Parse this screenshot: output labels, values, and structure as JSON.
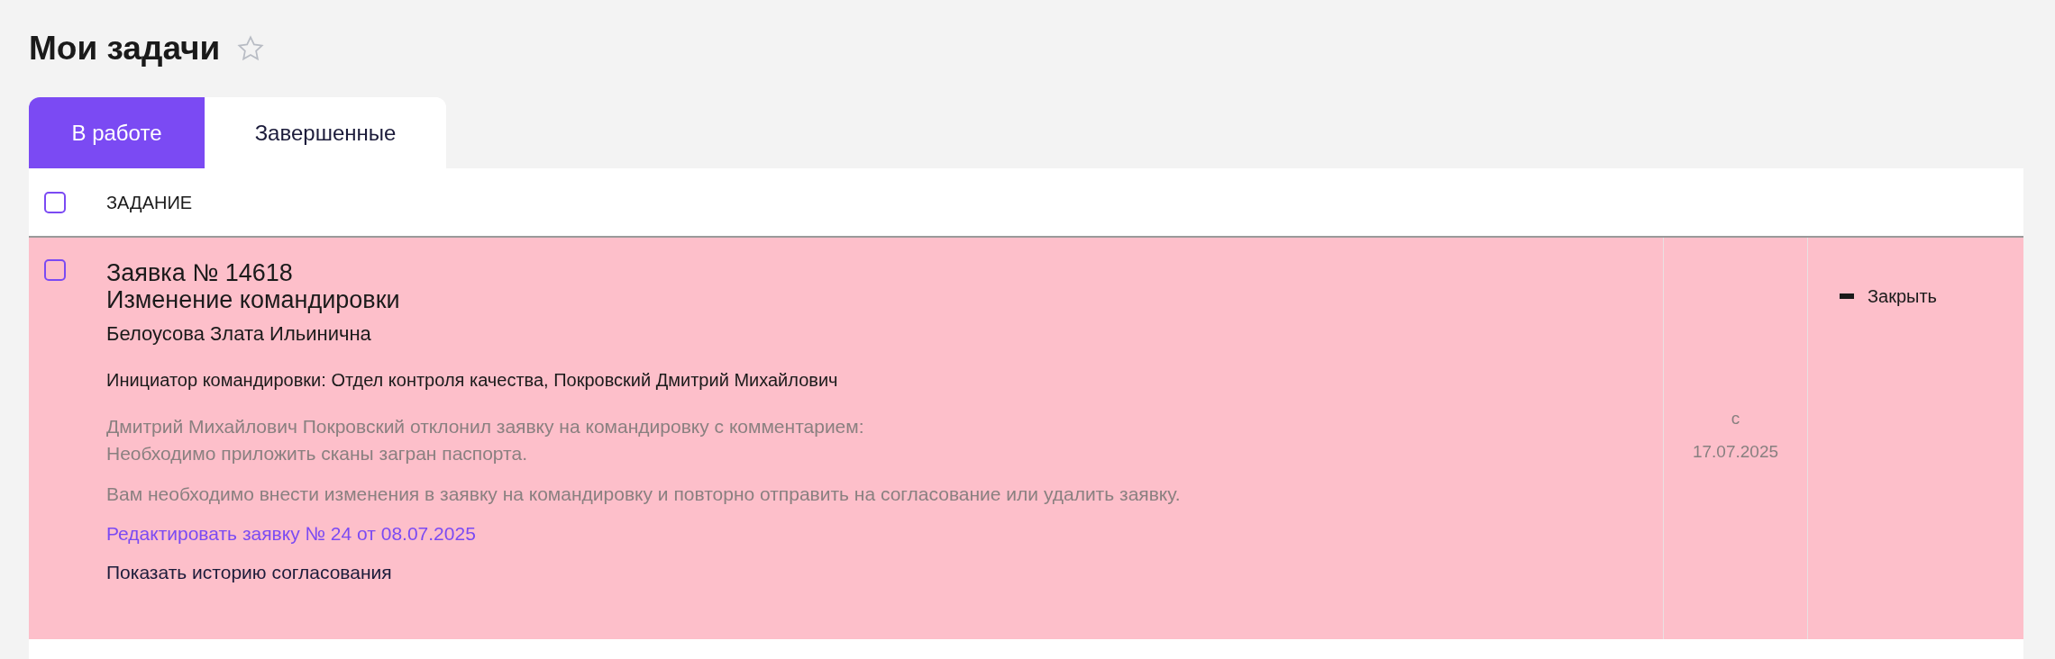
{
  "page_title": "Мои задачи",
  "favorite": false,
  "tabs": [
    {
      "label": "В работе",
      "selected": true
    },
    {
      "label": "Завершенные",
      "selected": false
    }
  ],
  "table": {
    "header": {
      "checked": false,
      "column_1": "ЗАДАНИЕ"
    },
    "rows": [
      {
        "checked": false,
        "title": "Заявка № 14618",
        "subtitle": "Изменение командировки",
        "person": "Белоусова Злата Ильинична",
        "initiator": "Инициатор командировки: Отдел контроля качества, Покровский Дмитрий Михайлович",
        "comment_lines": [
          "Дмитрий Михайлович Покровский отклонил заявку на командировку с комментарием:",
          "Необходимо приложить сканы загран паспорта."
        ],
        "instruction": "Вам необходимо внести изменения в заявку на командировку и повторно отправить на согласование или удалить заявку.",
        "edit_link": "Редактировать заявку № 24 от 08.07.2025",
        "history_link": "Показать историю согласования",
        "date_prefix": "с",
        "date": "17.07.2025",
        "action": "Закрыть"
      }
    ]
  }
}
